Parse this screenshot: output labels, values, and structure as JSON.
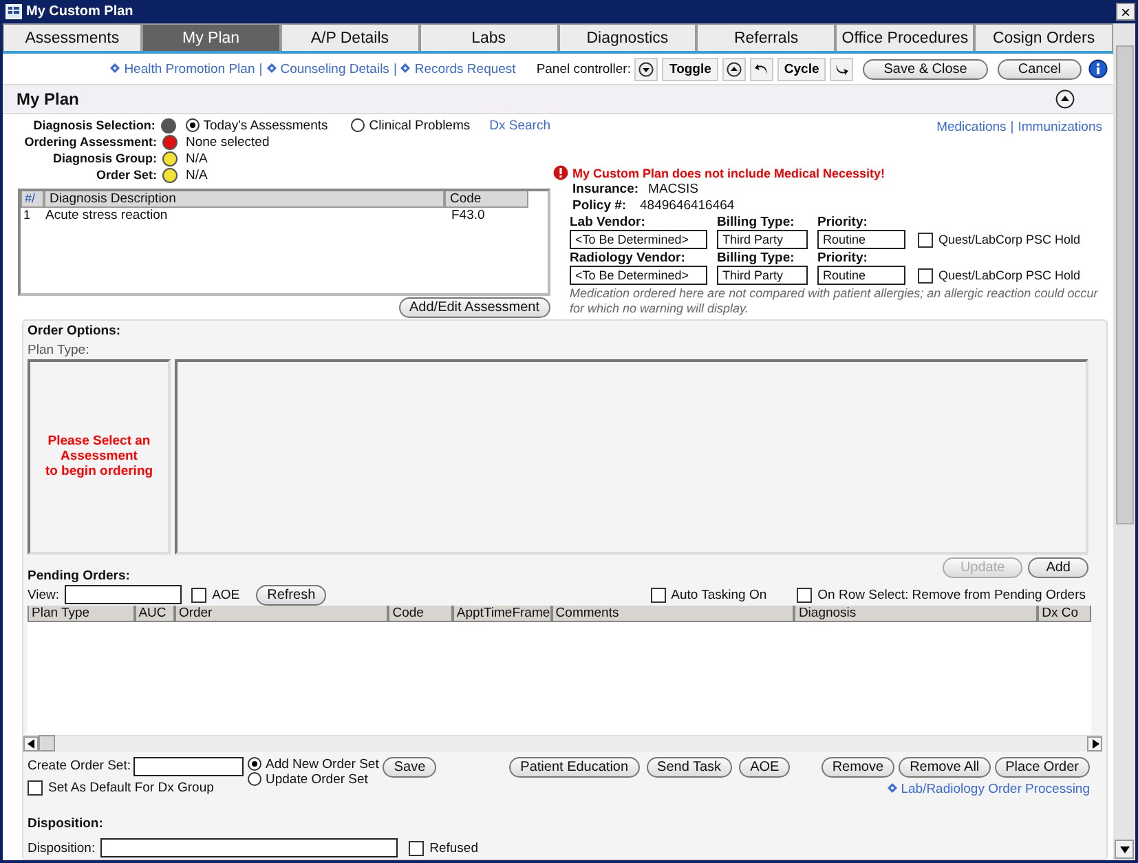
{
  "window": {
    "title": "My Custom Plan",
    "close": "×"
  },
  "tabs": [
    {
      "label": "Assessments",
      "selected": false
    },
    {
      "label": "My Plan",
      "selected": true
    },
    {
      "label": "A/P Details",
      "selected": false
    },
    {
      "label": "Labs",
      "selected": false
    },
    {
      "label": "Diagnostics",
      "selected": false
    },
    {
      "label": "Referrals",
      "selected": false
    },
    {
      "label": "Office Procedures",
      "selected": false
    },
    {
      "label": "Cosign Orders",
      "selected": false
    }
  ],
  "toolbar": {
    "links": [
      "Health Promotion Plan",
      "Counseling Details",
      "Records Request"
    ],
    "separator": "|",
    "panel_controller": "Panel controller:",
    "toggle": "Toggle",
    "cycle": "Cycle",
    "buttons": [
      "Save & Close",
      "Cancel"
    ]
  },
  "section_title": "My Plan",
  "diagnosis": {
    "rows": [
      {
        "label": "Diagnosis Selection:",
        "color": "#555555",
        "kind": "radios",
        "options": [
          {
            "label": "Today's Assessments",
            "selected": true
          },
          {
            "label": "Clinical Problems",
            "selected": false
          }
        ],
        "link": "Dx Search"
      },
      {
        "label": "Ordering Assessment:",
        "color": "#e01010",
        "kind": "text",
        "value": "None selected"
      },
      {
        "label": "Diagnosis Group:",
        "color": "#f2e234",
        "kind": "text",
        "value": "N/A"
      },
      {
        "label": "Order Set:",
        "color": "#f2e234",
        "kind": "text",
        "value": "N/A"
      }
    ],
    "right_links": [
      "Medications",
      "Immunizations"
    ],
    "separator": "|",
    "table": {
      "columns": [
        "#/",
        "Diagnosis Description",
        "Code"
      ],
      "rows": [
        [
          "1",
          "Acute stress reaction",
          "F43.0"
        ]
      ]
    },
    "button": "Add/Edit Assessment"
  },
  "insurance": {
    "warning": "My Custom Plan does not include Medical Necessity!",
    "insurance_label": "Insurance:",
    "insurance": "MACSIS",
    "policy_label": "Policy #:",
    "policy": "4849646416464",
    "vendors": [
      {
        "vendor_label": "Lab Vendor:",
        "vendor": "<To Be Determined>",
        "billing_label": "Billing Type:",
        "billing": "Third Party",
        "priority_label": "Priority:",
        "priority": "Routine",
        "hold": "Quest/LabCorp PSC Hold",
        "checked": false
      },
      {
        "vendor_label": "Radiology Vendor:",
        "vendor": "<To Be Determined>",
        "billing_label": "Billing Type:",
        "billing": "Third Party",
        "priority_label": "Priority:",
        "priority": "Routine",
        "hold": "Quest/LabCorp PSC Hold",
        "checked": false
      }
    ],
    "note": "Medication ordered here are not compared with patient allergies; an allergic reaction could occur for which no warning will display."
  },
  "order_options": {
    "title": "Order Options:",
    "plan_type": "Plan Type:",
    "message": "Please Select an\nAssessment\nto begin ordering",
    "buttons": [
      {
        "label": "Update",
        "disabled": true
      },
      {
        "label": "Add",
        "disabled": false
      }
    ]
  },
  "pending": {
    "title": "Pending Orders:",
    "view_label": "View:",
    "aoe": {
      "label": "AOE",
      "checked": false
    },
    "refresh": "Refresh",
    "auto_tasking": {
      "label": "Auto Tasking On",
      "checked": false
    },
    "row_select": {
      "label": "On Row Select: Remove from Pending Orders",
      "checked": false
    },
    "columns": [
      "Plan Type",
      "AUC",
      "Order",
      "Code",
      "ApptTimeFrame",
      "Comments",
      "Diagnosis",
      "Dx Co"
    ]
  },
  "order_set": {
    "label": "Create Order Set:",
    "options": [
      {
        "label": "Add New Order Set",
        "selected": true
      },
      {
        "label": "Update Order Set",
        "selected": false
      }
    ],
    "save": "Save",
    "default": {
      "label": "Set As Default For Dx Group",
      "checked": false
    },
    "buttons": [
      "Patient Education",
      "Send Task",
      "AOE"
    ],
    "right_buttons": [
      "Remove",
      "Remove All",
      "Place Order"
    ],
    "link": "Lab/Radiology Order Processing"
  },
  "disposition": {
    "title": "Disposition:",
    "label": "Disposition:",
    "refused": {
      "label": "Refused",
      "checked": false
    }
  }
}
